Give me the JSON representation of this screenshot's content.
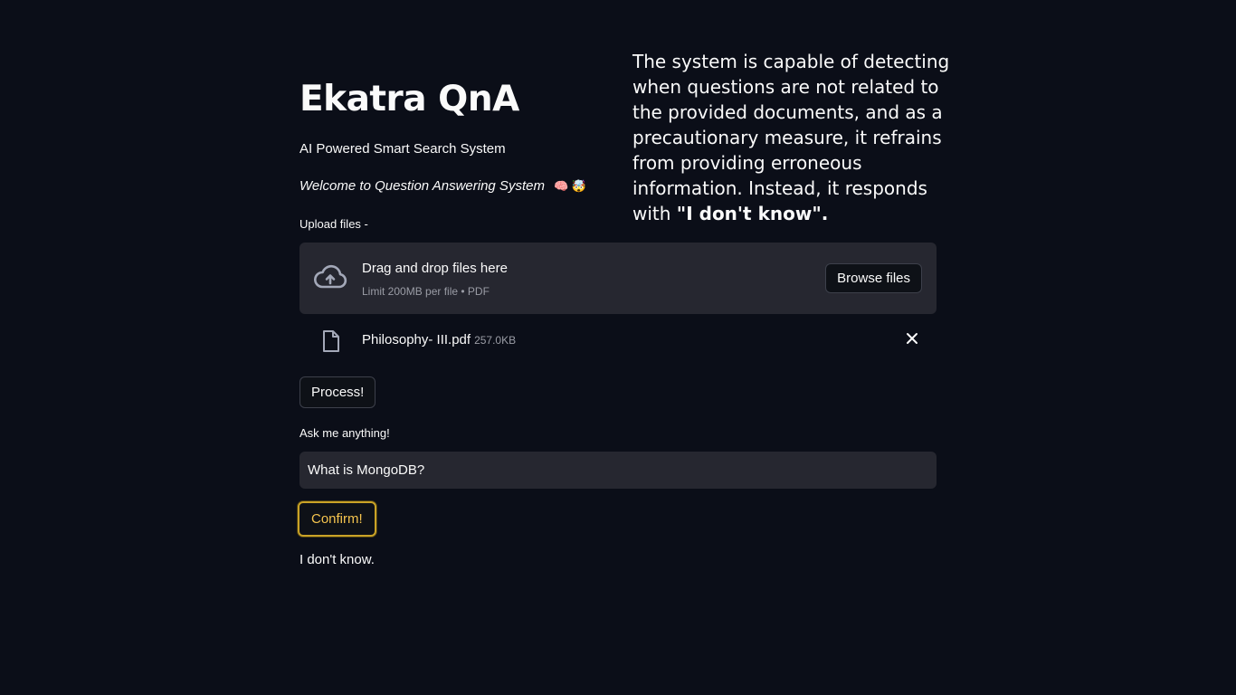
{
  "app": {
    "title": "Ekatra QnA",
    "subtitle": "AI Powered Smart Search System",
    "welcome": "Welcome to Question Answering System",
    "welcome_emoji": "🧠 🤯"
  },
  "side_note": {
    "text": "The system is capable of detecting when questions are not related to the provided documents, and as a precautionary measure, it refrains from providing erroneous information. Instead, it responds with ",
    "emphasis": "\"I don't know\".",
    "trailing": ""
  },
  "uploader": {
    "label": "Upload files -",
    "drop_title": "Drag and drop files here",
    "drop_limit": "Limit 200MB per file • PDF",
    "browse_label": "Browse files",
    "icon": "cloud-upload-icon"
  },
  "uploaded_file": {
    "name": "Philosophy- III.pdf",
    "size": "257.0KB",
    "icon": "file-icon"
  },
  "actions": {
    "process_label": "Process!",
    "confirm_label": "Confirm!"
  },
  "question": {
    "label": "Ask me anything!",
    "value": "What is MongoDB?"
  },
  "answer": {
    "text": "I don't know."
  },
  "colors": {
    "background": "#0b0e18",
    "widget": "#262730",
    "accent_focus": "#c9a227",
    "focus_text": "#f5c44e"
  }
}
